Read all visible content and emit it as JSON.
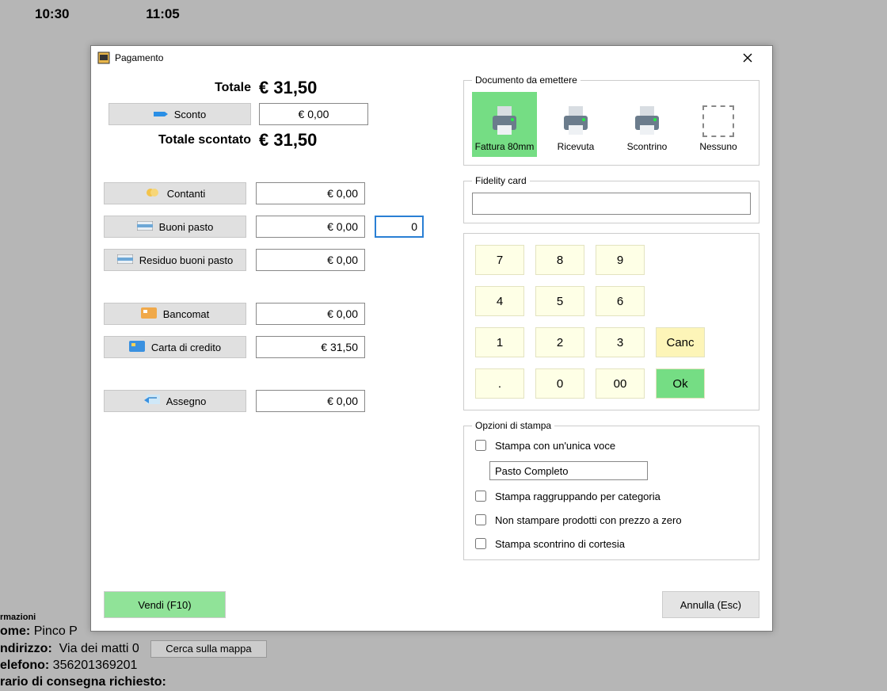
{
  "background": {
    "times": [
      "10:30",
      "11:05"
    ],
    "info_title": "rmazioni",
    "lines": [
      {
        "label": "ome:",
        "value": "Pinco P"
      },
      {
        "label": "ndirizzo:",
        "value": "Via dei matti 0",
        "map_button": "Cerca sulla mappa"
      },
      {
        "label": "elefono:",
        "value": "356201369201"
      }
    ]
  },
  "modal": {
    "title": "Pagamento",
    "totals": {
      "total_label": "Totale",
      "total_value": "€ 31,50",
      "discount_label": "Sconto",
      "discount_value": "€ 0,00",
      "discounted_label": "Totale scontato",
      "discounted_value": "€ 31,50"
    },
    "payments": [
      {
        "id": "contanti",
        "label": "Contanti",
        "value": "€ 0,00"
      },
      {
        "id": "buoni",
        "label": "Buoni pasto",
        "value": "€ 0,00",
        "qty": "0"
      },
      {
        "id": "residuo",
        "label": "Residuo buoni pasto",
        "value": "€ 0,00"
      },
      "spacer",
      {
        "id": "bancomat",
        "label": "Bancomat",
        "value": "€ 0,00"
      },
      {
        "id": "carta",
        "label": "Carta di credito",
        "value": "€ 31,50"
      },
      "spacer",
      {
        "id": "assegno",
        "label": "Assegno",
        "value": "€ 0,00"
      }
    ],
    "document": {
      "legend": "Documento da emettere",
      "options": [
        {
          "id": "fattura",
          "label": "Fattura 80mm",
          "selected": true
        },
        {
          "id": "ricevuta",
          "label": "Ricevuta"
        },
        {
          "id": "scontrino",
          "label": "Scontrino"
        },
        {
          "id": "nessuno",
          "label": "Nessuno",
          "none": true
        }
      ]
    },
    "fidelity": {
      "legend": "Fidelity card",
      "value": ""
    },
    "keypad": [
      "7",
      "8",
      "9",
      "",
      "4",
      "5",
      "6",
      "",
      "1",
      "2",
      "3",
      "Canc",
      ".",
      "0",
      "00",
      "Ok"
    ],
    "print": {
      "legend": "Opzioni di stampa",
      "unica_voce": "Stampa con un'unica voce",
      "unica_voce_value": "Pasto Completo",
      "group_cat": "Stampa raggruppando per categoria",
      "no_zero": "Non stampare prodotti con prezzo a zero",
      "cortesia": "Stampa scontrino di cortesia"
    },
    "footer": {
      "vendi": "Vendi (F10)",
      "annulla": "Annulla (Esc)"
    }
  }
}
